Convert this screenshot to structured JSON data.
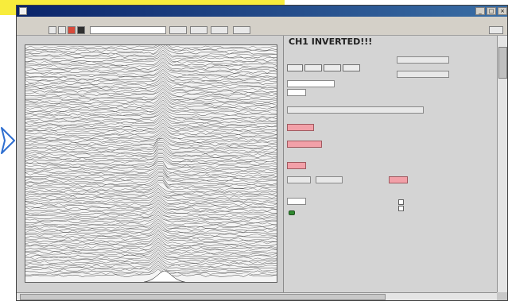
{
  "window": {
    "title": "",
    "menu": [
      "",
      "",
      "",
      "",
      "",
      "",
      "",
      "",
      ""
    ]
  },
  "graph": {
    "label": "",
    "x_ticks": [
      "",
      "",
      "",
      "",
      "",
      "",
      "",
      "",
      "",
      "",
      "",
      ""
    ]
  },
  "panel": {
    "headline": "CH1 INVERTED!!!",
    "labels": [
      "",
      "",
      "",
      "",
      "",
      "",
      "",
      "",
      "",
      "",
      "",
      "",
      "",
      "",
      "",
      ""
    ],
    "fields": [
      "",
      "",
      "",
      "",
      "",
      "",
      "",
      "",
      "",
      "",
      "",
      ""
    ]
  },
  "colors": {
    "highlight_yellow": "#f8ec3c",
    "arrow_blue": "#2f6fd0",
    "red_field": "#f2a0a8",
    "led_green": "#2f8a2f",
    "title_blue": "#0a246a"
  }
}
